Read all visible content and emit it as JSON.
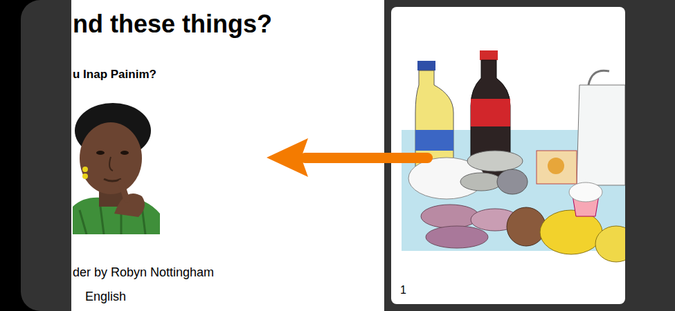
{
  "page_left": {
    "title": "nd these things?",
    "subtitle": "u Inap Painim?",
    "credit": "der by Robyn Nottingham",
    "language": "English"
  },
  "page_right": {
    "page_number": "1"
  },
  "swipe_hint": {
    "direction": "left"
  }
}
